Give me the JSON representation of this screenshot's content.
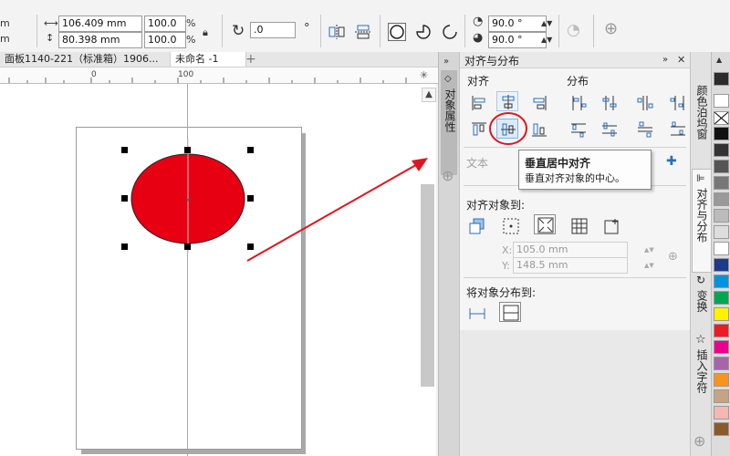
{
  "propbar": {
    "partial_left_1": "m",
    "partial_left_2": "m",
    "width_value": "106.409 mm",
    "height_value": "80.398 mm",
    "scale_x": "100.0",
    "scale_y": "100.0",
    "percent": "%",
    "rotation_value": ".0",
    "degree_symbol": "°",
    "start_angle": "90.0 °",
    "end_angle": "90.0 °"
  },
  "tabs": {
    "doc1": "面板1140-221（标准箱）1906...",
    "doc2": "未命名 -1",
    "add": "+"
  },
  "ruler": {
    "ticks": [
      "0",
      "100"
    ]
  },
  "docker_left": {
    "label": "对象属性"
  },
  "panel": {
    "title": "对齐与分布",
    "align_header": "对齐",
    "distribute_header": "分布",
    "text_label": "文本",
    "align_to_header": "对齐对象到:",
    "x_label": "X:",
    "x_value": "105.0 mm",
    "y_label": "Y:",
    "y_value": "148.5 mm",
    "distribute_to_header": "将对象分布到:"
  },
  "tooltip": {
    "title": "垂直居中对齐",
    "desc": "垂直对齐对象的中心。"
  },
  "right_tabs": {
    "color_docker": "颜色泊坞窗",
    "align_docker": "对齐与分布",
    "transform": "变换",
    "insert_char": "插入字符"
  },
  "colors": {
    "ellipse_fill": "#e60012",
    "annotation_red": "#e0141e",
    "palette": [
      "#2b2b2b",
      "#ffffff",
      "#111111",
      "#333333",
      "#555555",
      "#777777",
      "#999999",
      "#bbbbbb",
      "#dddddd",
      "#ffffff",
      "#1e3a8a",
      "#0093dd",
      "#00a651",
      "#fff200",
      "#ed1c24",
      "#ec008c",
      "#a864a8",
      "#f7941d",
      "#c4a484",
      "#f5b7b1",
      "#8b5a2b"
    ]
  }
}
